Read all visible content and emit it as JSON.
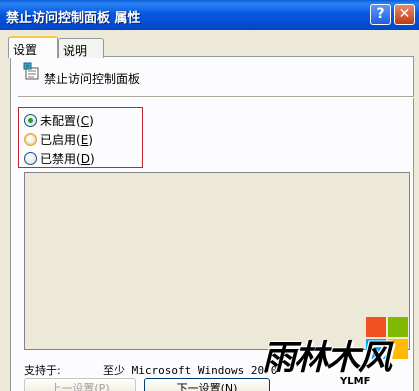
{
  "window": {
    "title": "禁止访问控制面板 属性",
    "help_button": "?",
    "close_button": "✕"
  },
  "tabs": [
    {
      "label": "设置",
      "active": true
    },
    {
      "label": "说明",
      "active": false
    }
  ],
  "setting": {
    "icon": "policy-setting-icon",
    "name": "禁止访问控制面板"
  },
  "options": [
    {
      "label": "未配置",
      "key": "C",
      "selected": true
    },
    {
      "label": "已启用",
      "key": "E",
      "selected": false
    },
    {
      "label": "已禁用",
      "key": "D",
      "selected": false
    }
  ],
  "supported": {
    "label": "支持于:",
    "value": "至少 Microsoft Windows 2000"
  },
  "buttons": {
    "prev": "上一设置(P)",
    "next": "下一设置(N)"
  },
  "watermark": {
    "text": "雨林木风",
    "sub": "YLMF"
  },
  "colors": {
    "titlebar": "#0a5fd8",
    "highlight_border": "#c0282d",
    "dialog_bg": "#ece9d8"
  }
}
